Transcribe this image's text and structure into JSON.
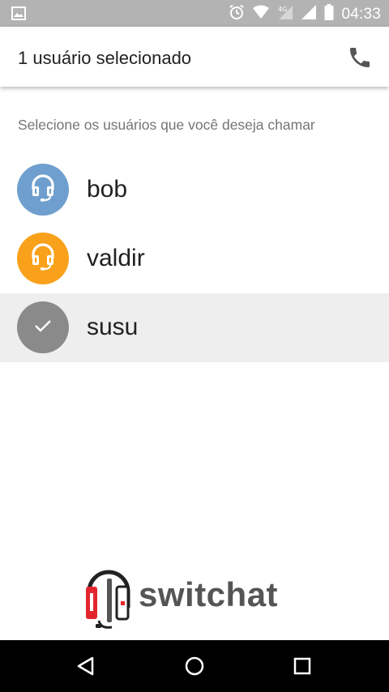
{
  "status_bar": {
    "time": "04:33",
    "icons": [
      "image-icon",
      "alarm-icon",
      "wifi-icon",
      "signal-4g-icon",
      "signal-icon",
      "battery-icon"
    ]
  },
  "app_bar": {
    "title": "1 usuário selecionado",
    "call_icon": "phone-icon"
  },
  "instruction": "Selecione os usuários que você deseja chamar",
  "users": [
    {
      "name": "bob",
      "avatar_color": "#6f9fce",
      "selected": false
    },
    {
      "name": "valdir",
      "avatar_color": "#f9a11b",
      "selected": false
    },
    {
      "name": "susu",
      "avatar_color": "#8a8a8a",
      "selected": true
    }
  ],
  "logo": {
    "text": "switchat",
    "accent": "#e3262e"
  },
  "nav_bar": {
    "icons": [
      "back-icon",
      "home-icon",
      "recent-apps-icon"
    ]
  },
  "colors": {
    "status_bar": "#b3b3b3",
    "selected_row": "#eeeeee",
    "instruction_text": "#757575"
  }
}
